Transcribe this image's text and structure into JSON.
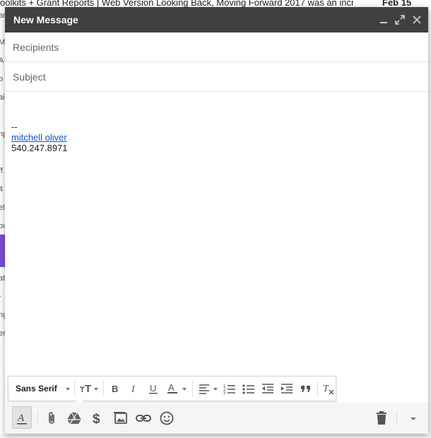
{
  "background": {
    "snippet_text": "oolkits + Grant Reports | Web Version Looking Back, Moving Forward 2017 was an incre",
    "date": "Feb 15",
    "left_fragments": [
      "ar",
      "Ml",
      "A",
      "o",
      "ai",
      "np",
      "ff",
      "4",
      "el",
      "ou",
      "at",
      "-",
      "ng",
      "er"
    ]
  },
  "compose": {
    "title": "New Message",
    "recipients_placeholder": "Recipients",
    "subject_placeholder": "Subject",
    "signature_dash": "--",
    "signature_name": "mitchell oliver",
    "signature_phone": "540.247.8971"
  },
  "toolbar": {
    "font_family": "Sans Serif"
  },
  "icons": {
    "minimize": "minimize-icon",
    "maximize": "expand-icon",
    "close": "close-icon",
    "text_size": "text-size-icon",
    "bold": "bold-icon",
    "italic": "italic-icon",
    "underline": "underline-icon",
    "text_color": "text-color-icon",
    "align": "align-icon",
    "numbered_list": "numbered-list-icon",
    "bullet_list": "bulleted-list-icon",
    "indent_less": "indent-less-icon",
    "indent_more": "indent-more-icon",
    "quote": "quote-icon",
    "remove_formatting": "clear-format-icon",
    "formatting": "formatting-options-icon",
    "attach": "paperclip-icon",
    "drive": "drive-icon",
    "money": "dollar-icon",
    "photo": "image-icon",
    "link": "link-icon",
    "emoji": "emoji-icon",
    "discard": "trash-icon",
    "more": "chevron-down-icon"
  },
  "colors": {
    "titlebar": "#404040",
    "link": "#1155cc",
    "selection_accent": "#7b4fd1"
  }
}
